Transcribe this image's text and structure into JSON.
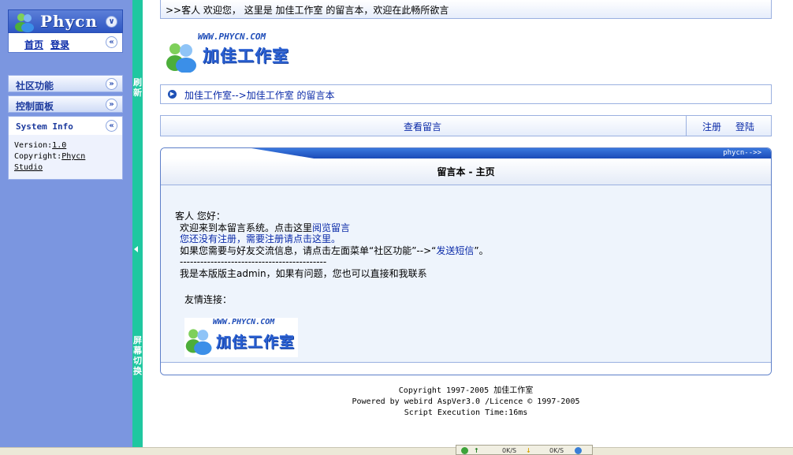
{
  "sidebar": {
    "logo_text": "Phycn",
    "home_label": "首页",
    "login_label": "登录",
    "menus": [
      {
        "label": "社区功能"
      },
      {
        "label": "控制面板"
      }
    ],
    "system_info": {
      "title": "System Info",
      "version_label": "Version:",
      "version_value": "1.0",
      "copyright_label": "Copyright:",
      "copyright_value_1": "Phycn",
      "copyright_value_2": "Studio"
    }
  },
  "strip": {
    "top_text": [
      "刷",
      "新"
    ],
    "bottom_text": [
      "屏",
      "幕",
      "切",
      "换"
    ]
  },
  "header": {
    "welcome": ">>客人 欢迎您， 这里是 加佳工作室 的留言本，欢迎在此畅所欲言",
    "logo_www": "WWW.PHYCN.COM",
    "logo_title": "加佳工作室"
  },
  "breadcrumb": {
    "text": "加佳工作室-->加佳工作室 的留言本"
  },
  "navbar": {
    "view": "查看留言",
    "register": "注册",
    "login": "登陆"
  },
  "panel": {
    "corner": "phycn-->>",
    "title": "留言本 - 主页",
    "greeting": "客人 您好：",
    "line1_prefix": "欢迎来到本留言系统。点击这里",
    "line1_link": "阅览留言",
    "line2": "您还没有注册，需要注册请点击这里。",
    "line3_prefix": "如果您需要与好友交流信息，请点击左面菜单“社区功能”-->“",
    "line3_link": "发送短信",
    "line3_suffix": "”。",
    "divider": "-------------------------------------------",
    "line4": "我是本版版主admin，如果有问题，您也可以直接和我联系",
    "friends_title": "友情连接：",
    "friend_logo_www": "WWW.PHYCN.COM",
    "friend_logo_title": "加佳工作室"
  },
  "footer": {
    "line1": "Copyright 1997-2005 加佳工作室",
    "line2": "Powered by webird AspVer3.0 /Licence © 1997-2005",
    "line3": "Script Execution Time:16ms"
  },
  "tray": {
    "speed1": "0K/S",
    "speed2": "0K/S"
  }
}
